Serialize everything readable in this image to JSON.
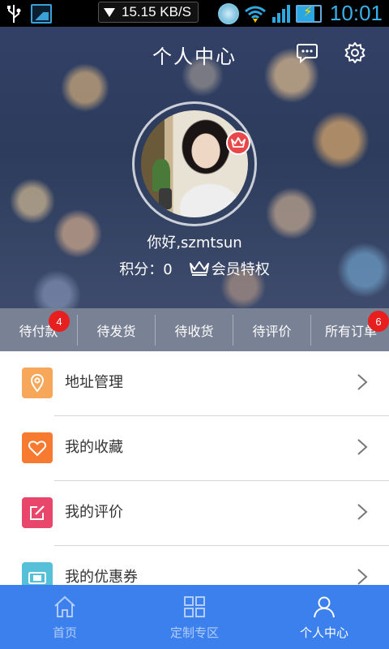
{
  "status_bar": {
    "net_speed": "15.15 KB/S",
    "time": "10:01"
  },
  "header": {
    "title": "个人中心",
    "message_icon": "chat-bubble-icon",
    "settings_icon": "gear-icon"
  },
  "profile": {
    "greeting": "你好,szmtsun",
    "points_text": "积分：0",
    "vip_label": "会员特权"
  },
  "orders": {
    "tabs": [
      {
        "label": "待付款",
        "badge": "4"
      },
      {
        "label": "待发货"
      },
      {
        "label": "待收货"
      },
      {
        "label": "待评价"
      },
      {
        "label": "所有订单",
        "badge": "6"
      }
    ]
  },
  "menu": [
    {
      "label": "地址管理",
      "icon": "location-pin-icon",
      "color": "#f6a75a"
    },
    {
      "label": "我的收藏",
      "icon": "heart-icon",
      "color": "#f67a2f"
    },
    {
      "label": "我的评价",
      "icon": "edit-icon",
      "color": "#e8466a"
    },
    {
      "label": "我的优惠券",
      "icon": "coupon-icon",
      "color": "#56c0d8"
    }
  ],
  "bottom_nav": [
    {
      "label": "首页",
      "icon": "home-icon"
    },
    {
      "label": "定制专区",
      "icon": "grid-icon"
    },
    {
      "label": "个人中心",
      "icon": "user-icon",
      "active": true
    }
  ],
  "colors": {
    "nav_bg": "#3c80ee",
    "badge_red": "#e81f1f",
    "crown_badge": "#e8484a"
  }
}
